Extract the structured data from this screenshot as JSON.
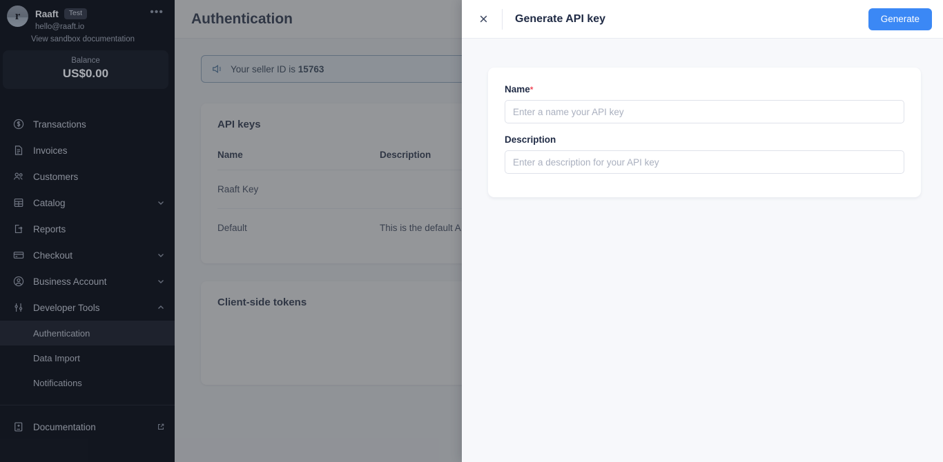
{
  "sidebar": {
    "account": {
      "avatar_letter": "r",
      "name": "Raaft",
      "badge": "Test",
      "email": "hello@raaft.io",
      "menu_icon": "ellipsis-icon",
      "sandbox_link": "View sandbox documentation"
    },
    "balance": {
      "label": "Balance",
      "value": "US$0.00"
    },
    "items": [
      {
        "label": "Transactions",
        "icon": "dollar-circle-icon",
        "expandable": false
      },
      {
        "label": "Invoices",
        "icon": "invoice-icon",
        "expandable": false
      },
      {
        "label": "Customers",
        "icon": "customers-icon",
        "expandable": false
      },
      {
        "label": "Catalog",
        "icon": "catalog-icon",
        "expandable": true
      },
      {
        "label": "Reports",
        "icon": "report-export-icon",
        "expandable": false
      },
      {
        "label": "Checkout",
        "icon": "credit-card-icon",
        "expandable": true
      },
      {
        "label": "Business Account",
        "icon": "user-circle-icon",
        "expandable": true
      },
      {
        "label": "Developer Tools",
        "icon": "sliders-icon",
        "expandable": true,
        "expanded": true
      }
    ],
    "developer_tools_children": [
      {
        "label": "Authentication",
        "active": true
      },
      {
        "label": "Data Import",
        "active": false
      },
      {
        "label": "Notifications",
        "active": false
      }
    ],
    "footer": {
      "label": "Documentation",
      "icon": "book-icon",
      "external_icon": "external-link-icon"
    }
  },
  "page": {
    "title": "Authentication",
    "banner": {
      "icon": "megaphone-icon",
      "text_prefix": "Your seller ID is ",
      "seller_id": "15763"
    },
    "api_keys_card": {
      "title": "API keys",
      "columns": [
        "Name",
        "Description"
      ],
      "rows": [
        {
          "name": "Raaft Key",
          "description": ""
        },
        {
          "name": "Default",
          "description": "This is the default A"
        }
      ]
    },
    "tokens_card": {
      "title": "Client-side tokens"
    }
  },
  "drawer": {
    "close_icon": "close-icon",
    "title": "Generate API key",
    "generate_button": "Generate",
    "fields": {
      "name": {
        "label": "Name",
        "required_marker": "*",
        "value": "",
        "placeholder": "Enter a name your API key"
      },
      "description": {
        "label": "Description",
        "value": "",
        "placeholder": "Enter a description for your API key"
      }
    }
  },
  "colors": {
    "sidebar_bg": "#161b25",
    "accent_blue": "#3b88f5",
    "required_red": "#f04a5a",
    "banner_border": "#8ea8c4",
    "page_bg": "#f7f8fa"
  }
}
